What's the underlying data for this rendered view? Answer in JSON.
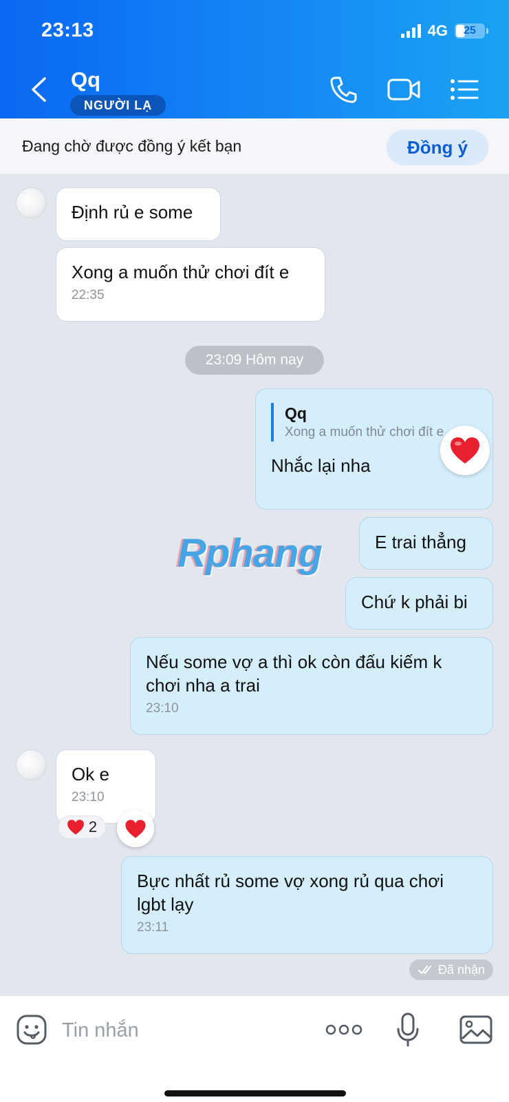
{
  "status_bar": {
    "time": "23:13",
    "network": "4G",
    "battery": "25"
  },
  "header": {
    "contact_name": "Qq",
    "badge": "NGƯỜI LẠ"
  },
  "friend_request": {
    "text": "Đang chờ được đồng ý kết bạn",
    "accept_label": "Đồng ý"
  },
  "messages": [
    {
      "text": "Định rủ e some"
    },
    {
      "text": "Xong a muốn thử chơi đít e",
      "time": "22:35"
    },
    {
      "text": "E trai thẳng"
    },
    {
      "text": "Chứ k phải bi"
    },
    {
      "text": "Nếu some vợ a thì ok còn đấu kiếm k chơi nha a trai",
      "time": "23:10"
    },
    {
      "text": "Ok e",
      "time": "23:10",
      "reaction_count": "2"
    },
    {
      "text": "Bực nhất rủ some vợ xong rủ qua chơi lgbt lạy",
      "time": "23:11"
    }
  ],
  "date_separator": "23:09 Hôm nay",
  "reply": {
    "quote_name": "Qq",
    "quote_text": "Xong a muốn thử chơi đít e",
    "text": "Nhắc lại nha"
  },
  "received_status": "Đã nhận",
  "watermark": "Rphang",
  "input": {
    "placeholder": "Tin nhắn"
  },
  "colors": {
    "header_blue": "#1587f5",
    "accent": "#0b5fd6",
    "outgoing_bubble": "#d5eefc",
    "heart": "#e8202f"
  },
  "icons": [
    "back-icon",
    "phone-icon",
    "video-call-icon",
    "menu-icon",
    "sticker-icon",
    "more-icon",
    "microphone-icon",
    "image-icon",
    "heart-icon",
    "double-check-icon"
  ]
}
